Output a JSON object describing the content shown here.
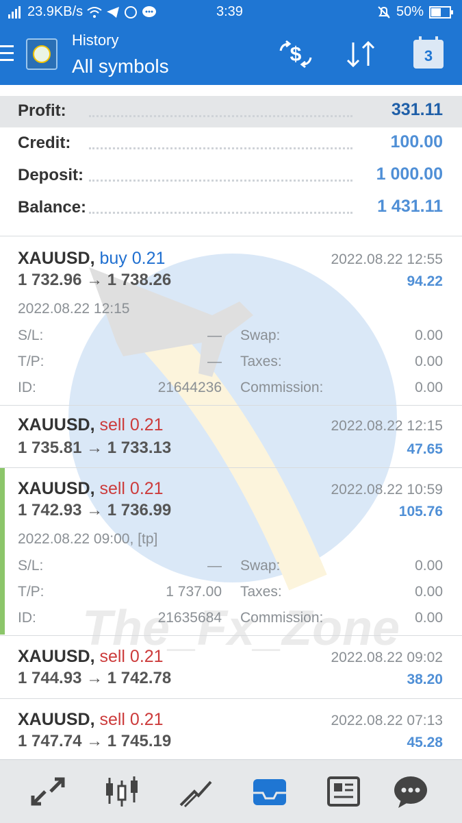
{
  "status": {
    "speed": "23.9KB/s",
    "time": "3:39",
    "battery": "50%"
  },
  "header": {
    "title_small": "History",
    "title_big": "All symbols",
    "calendar_day": "3"
  },
  "summary": {
    "profit_label": "Profit:",
    "profit_value": "331.11",
    "credit_label": "Credit:",
    "credit_value": "100.00",
    "deposit_label": "Deposit:",
    "deposit_value": "1 000.00",
    "balance_label": "Balance:",
    "balance_value": "1 431.11"
  },
  "trades": [
    {
      "symbol": "XAUUSD,",
      "side": "buy 0.21",
      "close_date": "2022.08.22 12:55",
      "prices": "1 732.96 → 1 738.26",
      "profit": "94.22",
      "open_date": "2022.08.22 12:15",
      "sl_label": "S/L:",
      "sl_value": "—",
      "tp_label": "T/P:",
      "tp_value": "—",
      "id_label": "ID:",
      "id_value": "21644236",
      "swap_label": "Swap:",
      "swap_value": "0.00",
      "taxes_label": "Taxes:",
      "taxes_value": "0.00",
      "commission_label": "Commission:",
      "commission_value": "0.00"
    },
    {
      "symbol": "XAUUSD,",
      "side": "sell 0.21",
      "close_date": "2022.08.22 12:15",
      "prices": "1 735.81 → 1 733.13",
      "profit": "47.65"
    },
    {
      "symbol": "XAUUSD,",
      "side": "sell 0.21",
      "close_date": "2022.08.22 10:59",
      "prices": "1 742.93 → 1 736.99",
      "profit": "105.76",
      "open_date": "2022.08.22 09:00, [tp]",
      "sl_label": "S/L:",
      "sl_value": "—",
      "tp_label": "T/P:",
      "tp_value": "1 737.00",
      "id_label": "ID:",
      "id_value": "21635684",
      "swap_label": "Swap:",
      "swap_value": "0.00",
      "taxes_label": "Taxes:",
      "taxes_value": "0.00",
      "commission_label": "Commission:",
      "commission_value": "0.00"
    },
    {
      "symbol": "XAUUSD,",
      "side": "sell 0.21",
      "close_date": "2022.08.22 09:02",
      "prices": "1 744.93 → 1 742.78",
      "profit": "38.20"
    },
    {
      "symbol": "XAUUSD,",
      "side": "sell 0.21",
      "close_date": "2022.08.22 07:13",
      "prices": "1 747.74 → 1 745.19",
      "profit": "45.28"
    }
  ],
  "watermark": "The_Fx_Zone",
  "icons": {
    "menu": "menu-icon",
    "currency": "currency-exchange-icon",
    "sort": "sort-icon",
    "calendar": "calendar-icon",
    "nav": [
      "quotes-icon",
      "chart-icon",
      "trade-icon",
      "history-icon",
      "news-icon",
      "chat-icon"
    ]
  },
  "colors": {
    "brand": "#1f76d3",
    "buy": "#1f6fd0",
    "sell": "#cc3b3b",
    "profit": "#4f8fd6",
    "accent": "#8cc66a"
  }
}
